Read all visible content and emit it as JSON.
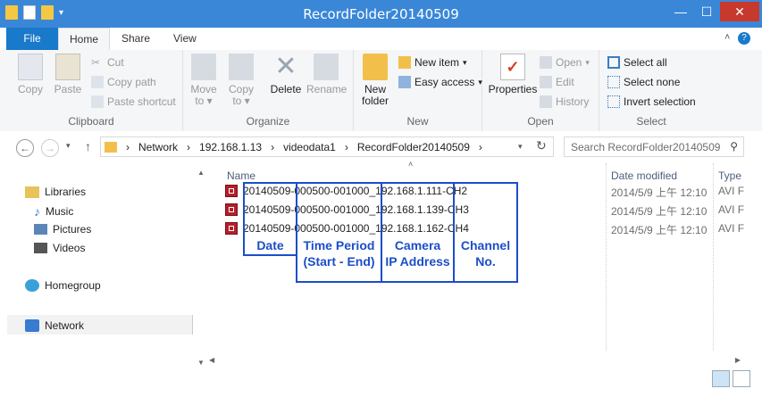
{
  "window": {
    "title": "RecordFolder20140509",
    "minimize": "—",
    "maximize": "☐",
    "close": "✕"
  },
  "tabs": {
    "file": "File",
    "home": "Home",
    "share": "Share",
    "view": "View"
  },
  "ribbon": {
    "clipboard": {
      "group": "Clipboard",
      "copy": "Copy",
      "paste": "Paste",
      "cut": "Cut",
      "copy_path": "Copy path",
      "paste_shortcut": "Paste shortcut"
    },
    "organize": {
      "group": "Organize",
      "move_to": "Move\nto",
      "copy_to": "Copy\nto",
      "delete": "Delete",
      "rename": "Rename"
    },
    "new": {
      "group": "New",
      "new_folder": "New\nfolder",
      "new_item": "New item",
      "easy_access": "Easy access"
    },
    "open": {
      "group": "Open",
      "properties": "Properties",
      "open": "Open",
      "edit": "Edit",
      "history": "History"
    },
    "select": {
      "group": "Select",
      "select_all": "Select all",
      "select_none": "Select none",
      "invert_selection": "Invert selection"
    }
  },
  "address": {
    "crumbs": [
      "Network",
      "192.168.1.13",
      "videodata1",
      "RecordFolder20140509"
    ],
    "search_placeholder": "Search RecordFolder20140509"
  },
  "nav": {
    "libraries": "Libraries",
    "music": "Music",
    "pictures": "Pictures",
    "videos": "Videos",
    "homegroup": "Homegroup",
    "network": "Network"
  },
  "columns": {
    "name": "Name",
    "date_modified": "Date modified",
    "type": "Type"
  },
  "files": [
    {
      "name": "20140509-000500-001000_192.168.1.111-CH2",
      "date": "2014/5/9 上午 12:10",
      "type": "AVI F"
    },
    {
      "name": "20140509-000500-001000_192.168.1.139-CH3",
      "date": "2014/5/9 上午 12:10",
      "type": "AVI F"
    },
    {
      "name": "20140509-000500-001000_192.168.1.162-CH4",
      "date": "2014/5/9 上午 12:10",
      "type": "AVI F"
    }
  ],
  "annotations": {
    "date": "Date",
    "time_period": "Time Period\n(Start - End)",
    "camera_ip": "Camera\nIP Address",
    "channel": "Channel\nNo.",
    "color": "#1c4ec9"
  }
}
